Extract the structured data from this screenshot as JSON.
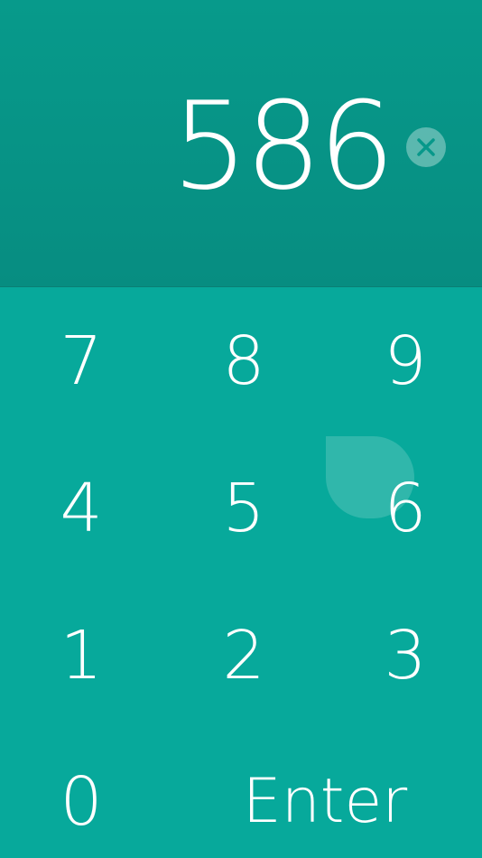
{
  "display": {
    "value": "586",
    "clear_icon": "close-icon"
  },
  "keypad": {
    "k7": "7",
    "k8": "8",
    "k9": "9",
    "k4": "4",
    "k5": "5",
    "k6": "6",
    "k1": "1",
    "k2": "2",
    "k3": "3",
    "k0": "0",
    "enter": "Enter"
  },
  "colors": {
    "display_background": "#07988A",
    "keypad_background": "#07A99B",
    "text": "#FFFFFF"
  }
}
